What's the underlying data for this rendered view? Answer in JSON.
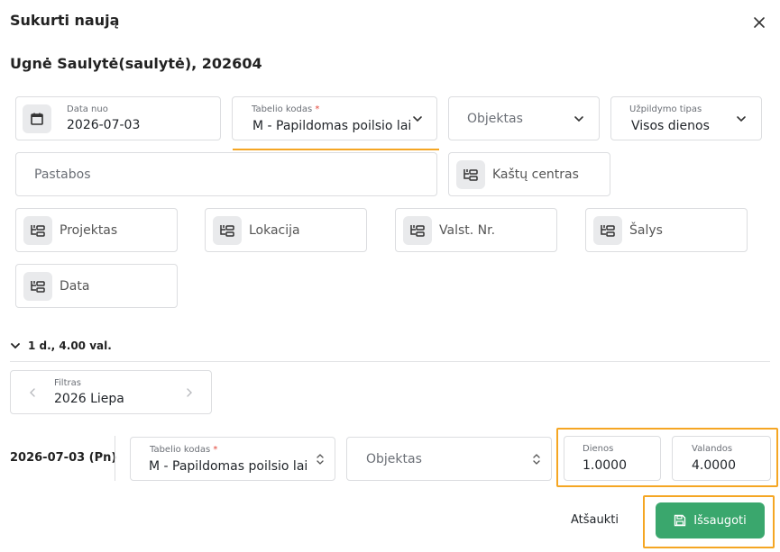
{
  "dialog": {
    "title": "Sukurti naują",
    "subtitle": "Ugnė Saulytė(saulytė), 202604"
  },
  "form": {
    "date_from": {
      "label": "Data nuo",
      "value": "2026-07-03"
    },
    "timesheet_code": {
      "label": "Tabelio kodas",
      "required_mark": "*",
      "value": "M - Papildomas poilsio laik"
    },
    "object": {
      "placeholder": "Objektas"
    },
    "fill_type": {
      "label": "Užpildymo tipas",
      "value": "Visos dienos"
    },
    "notes": {
      "placeholder": "Pastabos"
    },
    "cost_center": {
      "placeholder": "Kaštų centras"
    },
    "project": {
      "placeholder": "Projektas"
    },
    "location": {
      "placeholder": "Lokacija"
    },
    "plate": {
      "placeholder": "Valst. Nr."
    },
    "countries": {
      "placeholder": "Šalys"
    },
    "data": {
      "placeholder": "Data"
    }
  },
  "summary": {
    "text": "1 d., 4.00 val."
  },
  "filter": {
    "label": "Filtras",
    "value": "2026 Liepa"
  },
  "row": {
    "date": "2026-07-03 (Pn)",
    "timesheet_code": {
      "label": "Tabelio kodas",
      "required_mark": "*",
      "value": "M - Papildomas poilsio laika"
    },
    "object": {
      "placeholder": "Objektas"
    },
    "days": {
      "label": "Dienos",
      "value": "1.0000"
    },
    "hours": {
      "label": "Valandos",
      "value": "4.0000"
    }
  },
  "actions": {
    "cancel": "Atšaukti",
    "save": "Išsaugoti"
  },
  "colors": {
    "accent_green": "#3aa76d",
    "highlight_orange": "#f5a623"
  }
}
